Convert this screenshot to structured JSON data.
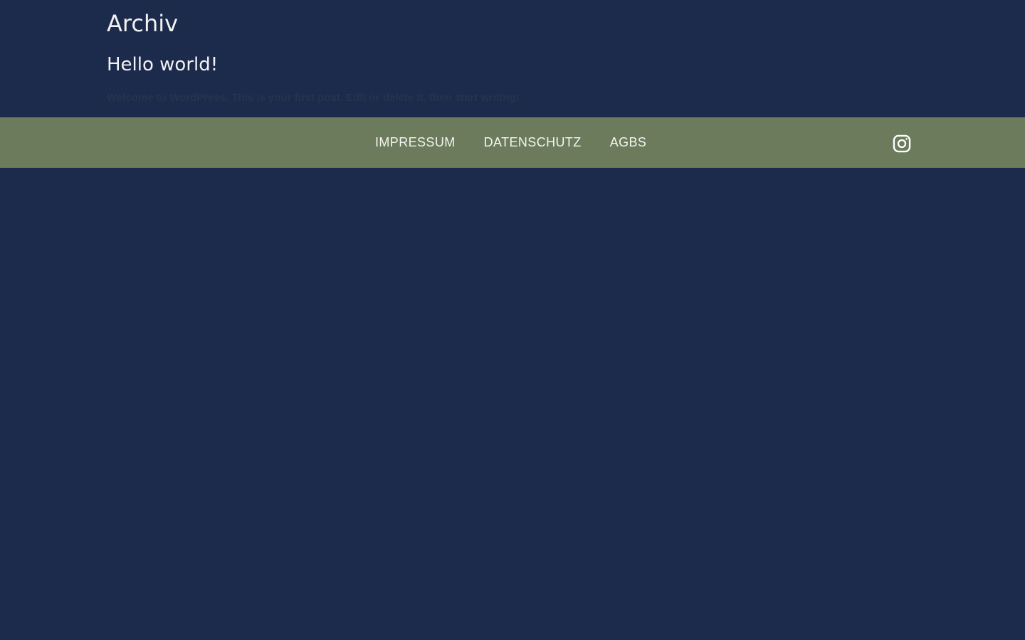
{
  "archive": {
    "title": "Archiv"
  },
  "post": {
    "title": "Hello world!",
    "excerpt": "Welcome to WordPress. This is your first post. Edit or delete it, then start writing!"
  },
  "footer": {
    "nav": [
      {
        "label": "IMPRESSUM"
      },
      {
        "label": "DATENSCHUTZ"
      },
      {
        "label": "AGBS"
      }
    ],
    "social": {
      "icon": "instagram-icon"
    }
  },
  "colors": {
    "background": "#1c2a4b",
    "footer_bar": "#6b7b5c",
    "text_light": "#f1f2f4",
    "excerpt_text": "#27334f"
  }
}
